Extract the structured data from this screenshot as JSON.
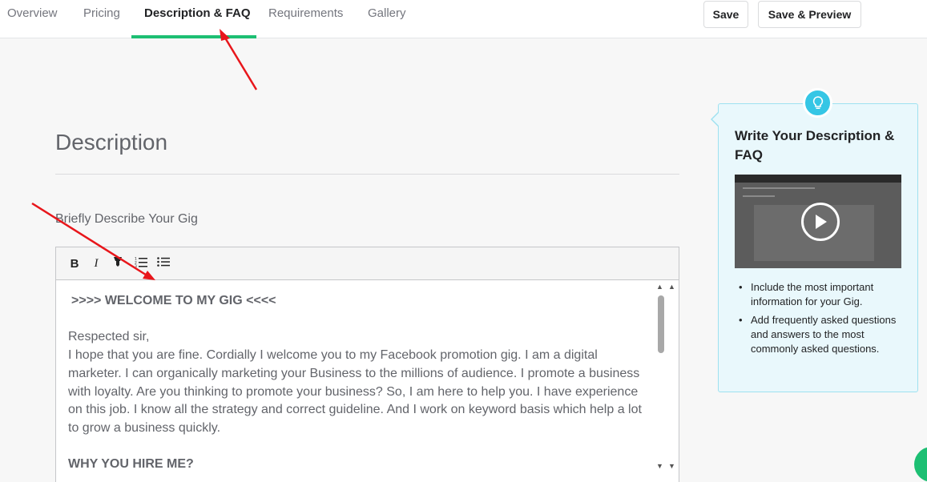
{
  "nav": {
    "tabs": [
      {
        "label": "Overview"
      },
      {
        "label": "Pricing"
      },
      {
        "label": "Description & FAQ",
        "active": true
      },
      {
        "label": "Requirements"
      },
      {
        "label": "Gallery"
      }
    ],
    "save_label": "Save",
    "save_preview_label": "Save & Preview"
  },
  "section": {
    "title": "Description",
    "field_label": "Briefly Describe Your Gig"
  },
  "editor": {
    "toolbar": {
      "bold": "B",
      "italic": "I"
    },
    "content": [
      {
        "text": " >>>> WELCOME TO MY GIG <<<<",
        "bold": true
      },
      {
        "text": "",
        "bold": false
      },
      {
        "text": "Respected sir,",
        "bold": false
      },
      {
        "text": "I hope that you are fine. Cordially I welcome you to my Facebook promotion gig. I am a digital marketer. I can organically marketing your Business to the millions of audience. I promote a business with loyalty. Are you thinking to promote your business? So, I am here to help you. I have experience on this job. I know all the strategy and correct guideline. And I work on keyword basis which help a lot to grow a business quickly.",
        "bold": false
      },
      {
        "text": "",
        "bold": false
      },
      {
        "text": "WHY YOU HIRE ME?",
        "bold": true
      }
    ]
  },
  "tip": {
    "title": "Write Your Description & FAQ",
    "bullets": [
      "Include the most important information for your Gig.",
      "Add frequently asked questions and answers to the most commonly asked questions."
    ]
  },
  "colors": {
    "accent": "#1dbf73",
    "tip_bg": "#e9f8fc",
    "tip_border": "#9ee1f0",
    "bulb": "#35c6e5",
    "annotation": "#e8161b"
  },
  "icons": {
    "bulb": "lightbulb-icon",
    "play": "play-icon",
    "marker": "marker-icon",
    "ordered_list": "ordered-list-icon",
    "bullet_list": "bullet-list-icon"
  }
}
